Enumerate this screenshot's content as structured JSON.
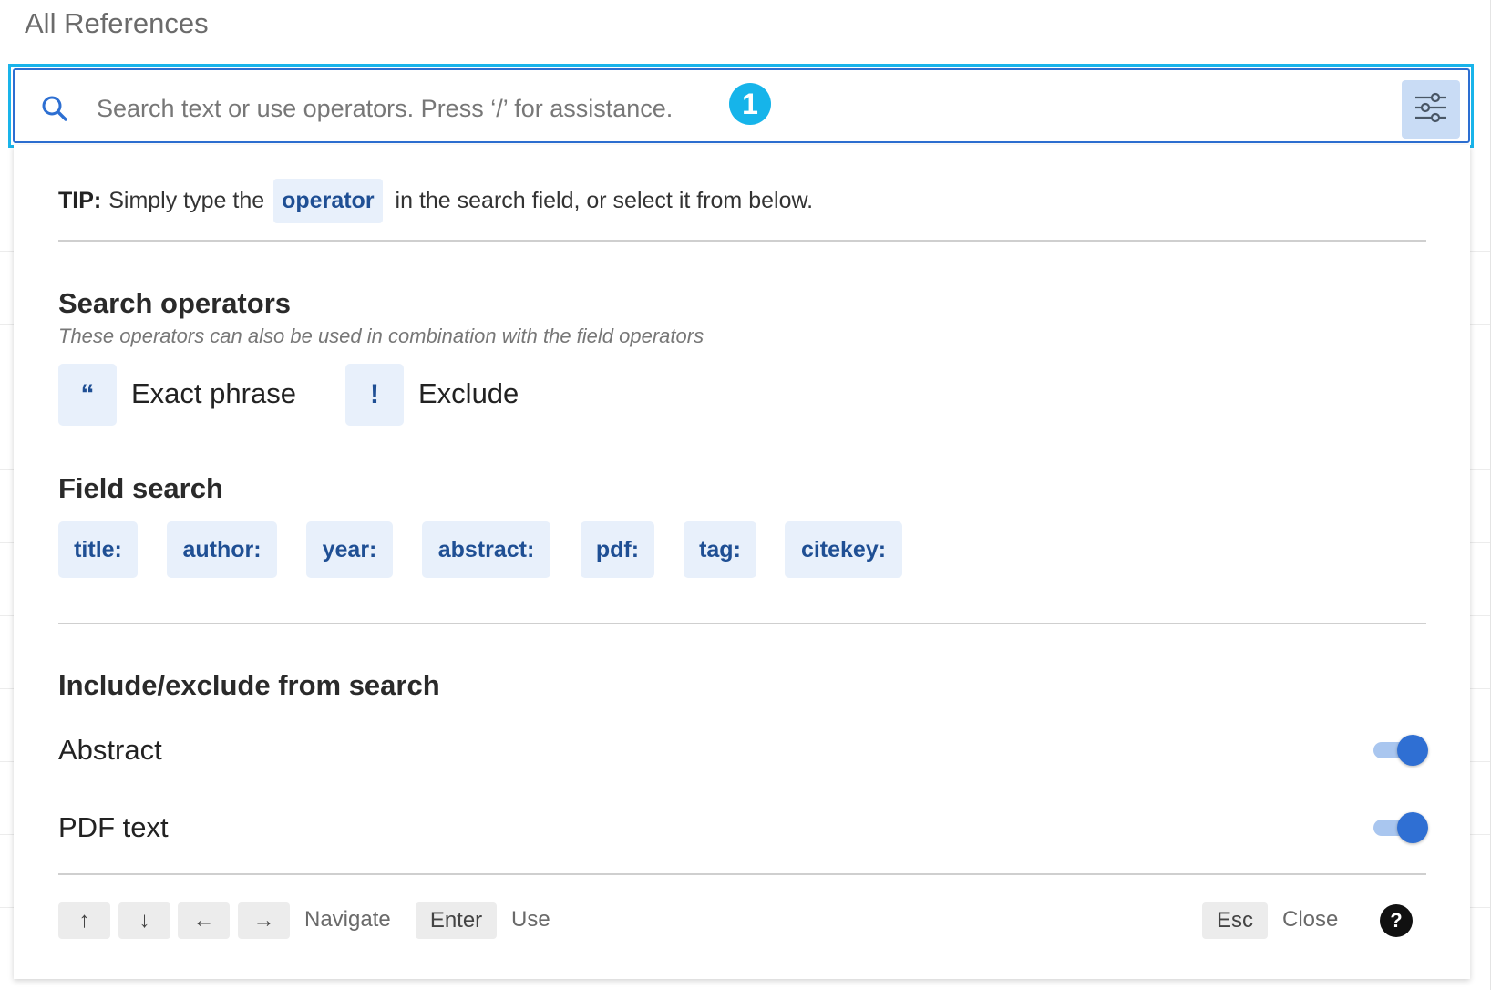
{
  "page_title": "All References",
  "search": {
    "placeholder": "Search text or use operators. Press ‘/’ for assistance.",
    "step_badge": "1",
    "filter_icon": "sliders-icon"
  },
  "tip": {
    "prefix": "TIP:",
    "before": "Simply type the",
    "chip": "operator",
    "after": "in the search field, or select it from below."
  },
  "search_operators": {
    "heading": "Search operators",
    "subtitle": "These operators can also be used in combination with the field operators",
    "items": [
      {
        "symbol": "“",
        "label": "Exact phrase"
      },
      {
        "symbol": "!",
        "label": "Exclude"
      }
    ]
  },
  "field_search": {
    "heading": "Field search",
    "items": [
      "title:",
      "author:",
      "year:",
      "abstract:",
      "pdf:",
      "tag:",
      "citekey:"
    ]
  },
  "include_exclude": {
    "heading": "Include/exclude from search",
    "toggles": [
      {
        "label": "Abstract",
        "on": true
      },
      {
        "label": "PDF text",
        "on": true
      }
    ]
  },
  "footer": {
    "keys": {
      "up": "↑",
      "down": "↓",
      "left": "←",
      "right": "→",
      "enter": "Enter",
      "esc": "Esc"
    },
    "navigate_label": "Navigate",
    "use_label": "Use",
    "close_label": "Close",
    "help": "?"
  },
  "colors": {
    "highlight": "#19b4ea",
    "accent": "#2f6fd3",
    "chip_bg": "#e8f0fb",
    "chip_text": "#1f4f94"
  }
}
